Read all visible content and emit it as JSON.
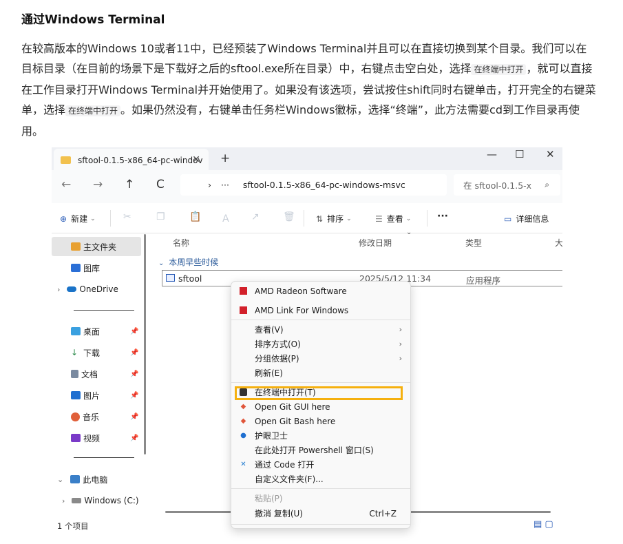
{
  "article": {
    "title": "通过Windows Terminal",
    "p_part1": "在较高版本的Windows 10或者11中，已经预装了Windows Terminal并且可以在直接切换到某个目录。我们可以在目标目录（在目前的场景下是下载好之后的sftool.exe所在目录）中，右键点击空白处，选择",
    "code1": "在终端中打开",
    "p_part2": "，就可以直接在工作目录打开Windows Terminal并开始使用了。如果没有该选项，尝试按住shift同时右键单击，打开完全的右键菜单，选择",
    "code2": "在终端中打开",
    "p_part3": "。如果仍然没有，右键单击任务栏Windows徽标，选择“终端”，此方法需要cd到工作目录再使用。"
  },
  "window": {
    "tab_title": "sftool-0.1.5-x86_64-pc-windov",
    "tab_close": "✕",
    "tab_new": "+",
    "minimize": "—",
    "maximize": "☐",
    "close": "✕",
    "nav": {
      "back": "←",
      "forward": "→",
      "up": "↑",
      "refresh": "C"
    },
    "address": {
      "chevron": "›",
      "ellipsis": "···",
      "path": "sftool-0.1.5-x86_64-pc-windows-msvc"
    },
    "search": {
      "placeholder": "在 sftool-0.1.5-x",
      "icon": "🔍"
    },
    "toolbar": {
      "new_label": "新建",
      "sort_label": "排序",
      "view_label": "查看",
      "more": "···",
      "details_label": "详细信息"
    },
    "sidebar": {
      "home": "主文件夹",
      "gallery": "图库",
      "onedrive": "OneDrive",
      "desktop": "桌面",
      "downloads": "下载",
      "documents": "文档",
      "pictures": "图片",
      "music": "音乐",
      "videos": "视频",
      "this_pc": "此电脑",
      "windows_c": "Windows (C:)"
    },
    "columns": {
      "name": "名称",
      "modified": "修改日期",
      "type": "类型",
      "size": "大"
    },
    "group_label": "本周早些时候",
    "file": {
      "name": "sftool",
      "date": "2025/5/12 11:34",
      "type": "应用程序"
    },
    "status": "1 个项目"
  },
  "context_menu": {
    "items": [
      {
        "label": "AMD Radeon Software"
      },
      {
        "label": "AMD Link For Windows"
      },
      {
        "label": "查看(V)"
      },
      {
        "label": "排序方式(O)"
      },
      {
        "label": "分组依据(P)"
      },
      {
        "label": "刷新(E)"
      },
      {
        "label": "在终端中打开(T)"
      },
      {
        "label": "Open Git GUI here"
      },
      {
        "label": "Open Git Bash here"
      },
      {
        "label": "护眼卫士"
      },
      {
        "label": "在此处打开 Powershell 窗口(S)"
      },
      {
        "label": "通过 Code 打开"
      },
      {
        "label": "自定义文件夹(F)..."
      },
      {
        "label": "粘贴(P)"
      },
      {
        "label": "撤消 复制(U)",
        "shortcut": "Ctrl+Z"
      }
    ]
  },
  "colors": {
    "highlight": "#f5b00e",
    "accent": "#2b5db8"
  }
}
